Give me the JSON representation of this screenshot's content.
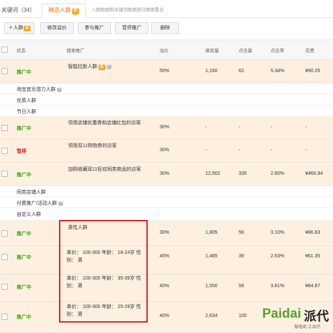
{
  "tabs": {
    "keywords": "关键词（34）",
    "crowd": "精选人群",
    "crowd_badge": "新",
    "merge_note": "人群数据和关键词数据部分数据重合"
  },
  "toolbar": {
    "add_crowd": "＋人群",
    "add_badge": "新",
    "edit_bid": "修改溢价",
    "join": "参与推广",
    "pause": "暂停推广",
    "delete": "删除"
  },
  "columns": {
    "status": "状态",
    "search": "搜索推广",
    "bid": "溢价",
    "impressions": "展现量",
    "clicks": "点击量",
    "ctr": "点击率",
    "cost": "花费"
  },
  "groups": {
    "taobao": "淘宝首页潜力人群",
    "quality": "优质人群",
    "holiday": "节日人群",
    "similar_shop": "同类店铺人群",
    "paid": "付费推广/活动人群",
    "custom": "自定义人群"
  },
  "rows": [
    {
      "status": "推广中",
      "name": "智能拉新人群",
      "badge": "新",
      "bid": "50%",
      "imp": "1,160",
      "clk": "62",
      "ctr": "5.34%",
      "cost": "¥90.25"
    },
    {
      "status": "推广中",
      "name": "领用店铺优惠券和店铺红包的访客",
      "bid": "30%",
      "imp": "-",
      "clk": "-",
      "ctr": "-",
      "cost": "-"
    },
    {
      "status": "暂停",
      "name": "领用双11购物券的访客",
      "bid": "30%",
      "imp": "-",
      "clk": "-",
      "ctr": "-",
      "cost": "-"
    },
    {
      "status": "推广中",
      "name": "加购收藏双11狂欢同类商品的访客",
      "bid": "30%",
      "imp": "12,902",
      "clk": "335",
      "ctr": "2.60%",
      "cost": "¥466.94"
    },
    {
      "status": "推广中",
      "name": "男性人群",
      "bid": "30%",
      "imp": "1,805",
      "clk": "56",
      "ctr": "3.10%",
      "cost": "¥86.63"
    },
    {
      "status": "推广中",
      "name": "单价：  100-300 年龄：  18-24岁 性别：  男",
      "bid": "45%",
      "imp": "1,485",
      "clk": "39",
      "ctr": "2.63%",
      "cost": "¥61.35"
    },
    {
      "status": "推广中",
      "name": "单价：  100-300 年龄：  35-39岁 性别：  男",
      "bid": "40%",
      "imp": "1,550",
      "clk": "59",
      "ctr": "3.81%",
      "cost": "¥84.87"
    },
    {
      "status": "推广中",
      "name": "单价：  100-300 年龄：  25-29岁 性别：  男",
      "bid": "40%",
      "imp": "2,634",
      "clk": "100",
      "ctr": "",
      "cost": ""
    }
  ],
  "watermark": {
    "latin": "Paidai",
    "cn": "派代",
    "sub": "做电商 上派代",
    "color": "#5aa02c"
  }
}
